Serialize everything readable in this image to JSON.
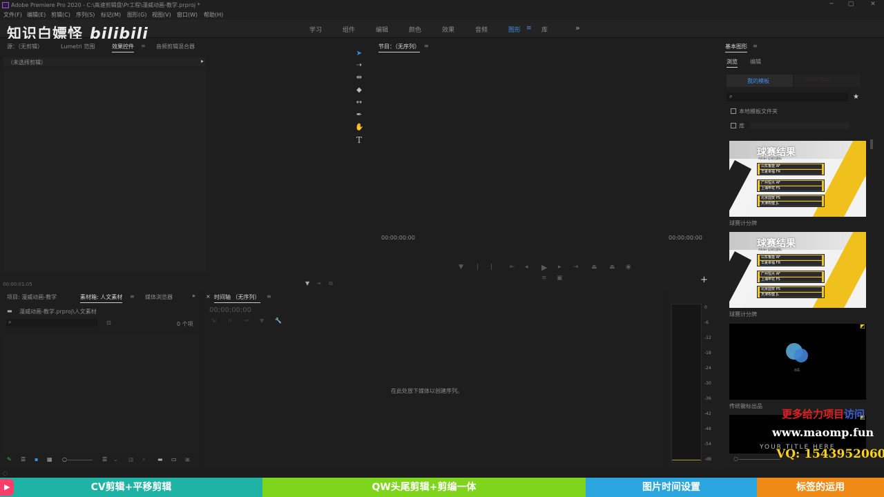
{
  "window": {
    "title": "Adobe Premiere Pro 2020 - C:\\高速剪辑盘\\Pr工程\\漫威动画-教学.prproj *",
    "controls": {
      "minimize": "─",
      "maximize": "▢",
      "close": "✕"
    }
  },
  "menu": [
    "文件(F)",
    "编辑(E)",
    "剪辑(C)",
    "序列(S)",
    "标记(M)",
    "图形(G)",
    "视图(V)",
    "窗口(W)",
    "帮助(H)"
  ],
  "workspaces": {
    "tabs": [
      "学习",
      "组件",
      "编辑",
      "颜色",
      "效果",
      "音频",
      "图形",
      "库"
    ],
    "active_index": 6,
    "more": "»"
  },
  "watermark": {
    "channel": "知识白嫖怪",
    "logo": "bilibili"
  },
  "source_panel": {
    "tabs": [
      "源：（无剪辑）",
      "Lumetri 范围",
      "效果控件",
      "音频剪辑混合器"
    ],
    "active_tab": "效果控件",
    "header": "（未选择剪辑）",
    "timecode": "00:00:01:05"
  },
  "program_panel": {
    "title": "节目：（无序列）",
    "timecode_left": "00:00:00:00",
    "timecode_right": "00:00:00:00"
  },
  "tools": [
    "selection",
    "track-select",
    "ripple-edit",
    "razor",
    "slip",
    "pen",
    "hand",
    "type"
  ],
  "project_panel": {
    "tabs": [
      "项目: 漫威动画-教学",
      "素材箱: 人文素材",
      "媒体浏览器"
    ],
    "active_tab": "素材箱: 人文素材",
    "path": "漫威动画-教学.prproj\\人文素材",
    "item_count": "0 个项"
  },
  "timeline_panel": {
    "title": "时间轴 （无序列）",
    "timecode": "00;00;00;00",
    "placeholder": "在此处放下媒体以创建序列。"
  },
  "audio_meter": {
    "labels": [
      "0",
      "-6",
      "-12",
      "-18",
      "-24",
      "-30",
      "-36",
      "-42",
      "-48",
      "-54",
      "-dB"
    ]
  },
  "essential_graphics": {
    "title": "基本图形",
    "tabs": [
      "浏览",
      "编辑"
    ],
    "active_tab": "浏览",
    "subtabs": [
      "我的模板",
      "Adobe Stock"
    ],
    "search_placeholder": "",
    "checkboxes": [
      "本地模板文件夹",
      "库"
    ],
    "templates": [
      {
        "name": "球赛计分牌",
        "thumb_title": "球赛结果",
        "thumb_sub": "Adobe 足球比赛标",
        "rows": [
          "山东鲁能 AF",
          "华夏幸福 FR",
          "广州恒大 AF",
          "上海申花 FS",
          "北京国安 PS",
          "天津权健 JL"
        ]
      },
      {
        "name": "球赛计分牌",
        "thumb_title": "球赛结果",
        "thumb_sub": "Adobe 足球比赛标",
        "rows": [
          "山东鲁能 AF",
          "华夏幸福 FR",
          "广州恒大 AF",
          "上海申花 FS",
          "北京国安 PS",
          "天津权健 JL"
        ]
      },
      {
        "name": "传统徽标出品",
        "caption": "出品"
      },
      {
        "name": "",
        "caption": "YOUR TITLE HERE"
      }
    ]
  },
  "promo": {
    "line1": "更多给力项目",
    "line1_b": "访问",
    "line2": "www.maomp.fun",
    "line3": "VQ: 1543952060"
  },
  "bottom_banner": {
    "segments": [
      {
        "label": "CV剪辑+平移剪辑",
        "color": "#1fb3a6"
      },
      {
        "label": "QW头尾剪辑+剪编一体",
        "color": "#7fd51b"
      },
      {
        "label": "图片时间设置",
        "color": "#2aa5dd"
      },
      {
        "label": "标签的运用",
        "color": "#f08a16"
      }
    ]
  }
}
